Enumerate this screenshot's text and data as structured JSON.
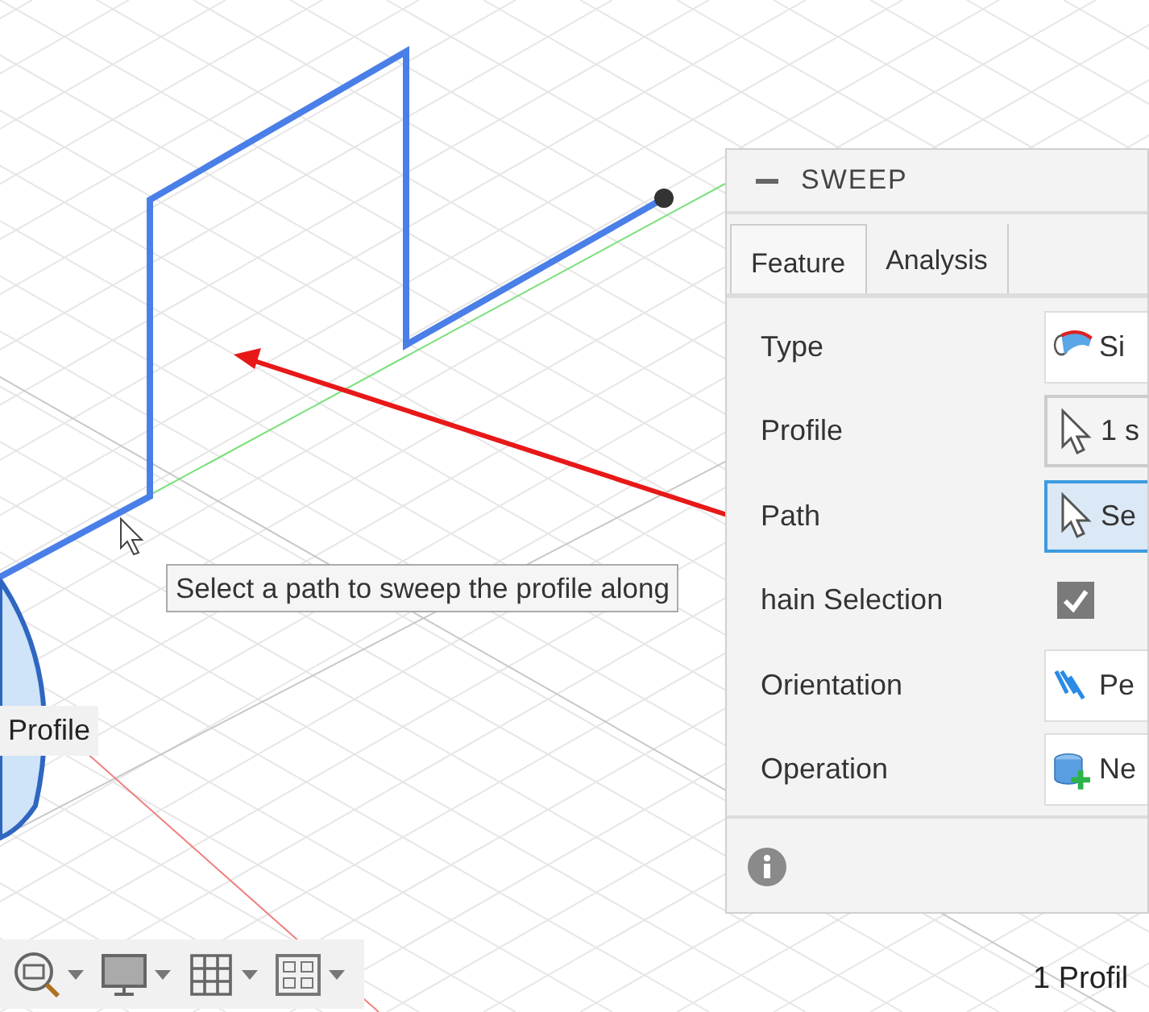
{
  "viewport": {
    "profile_label": "Profile",
    "tooltip": "Select a path to sweep the profile along",
    "status": "1 Profil"
  },
  "panel": {
    "title": "SWEEP",
    "tabs": [
      {
        "label": "Feature",
        "selected": true
      },
      {
        "label": "Analysis",
        "selected": false
      }
    ],
    "rows": [
      {
        "kind": "dropdown",
        "label": "Type",
        "value": "Si"
      },
      {
        "kind": "selection",
        "label": "Profile",
        "value": "1 s",
        "active": false
      },
      {
        "kind": "selection",
        "label": "Path",
        "value": "Se",
        "active": true
      },
      {
        "kind": "checkbox",
        "label": "hain Selection",
        "checked": true
      },
      {
        "kind": "dropdown",
        "label": "Orientation",
        "value": "Pe"
      },
      {
        "kind": "dropdown",
        "label": "Operation",
        "value": "Ne"
      }
    ]
  }
}
